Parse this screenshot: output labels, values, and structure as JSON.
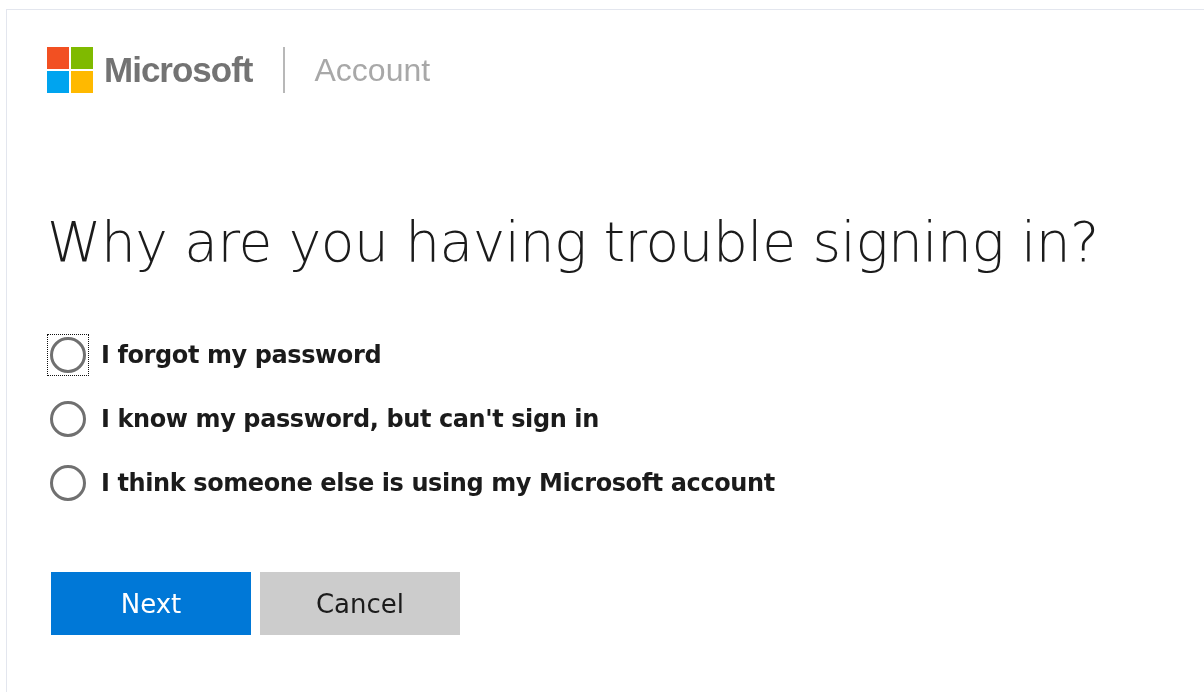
{
  "header": {
    "brand": "Microsoft",
    "section": "Account"
  },
  "heading": "Why are you having trouble signing in?",
  "options": [
    {
      "label": "I forgot my password",
      "selected": false,
      "focused": true
    },
    {
      "label": "I know my password, but can't sign in",
      "selected": false,
      "focused": false
    },
    {
      "label": "I think someone else is using my Microsoft account",
      "selected": false,
      "focused": false
    }
  ],
  "buttons": [
    {
      "label": "Next",
      "kind": "primary"
    },
    {
      "label": "Cancel",
      "kind": "secondary"
    }
  ]
}
